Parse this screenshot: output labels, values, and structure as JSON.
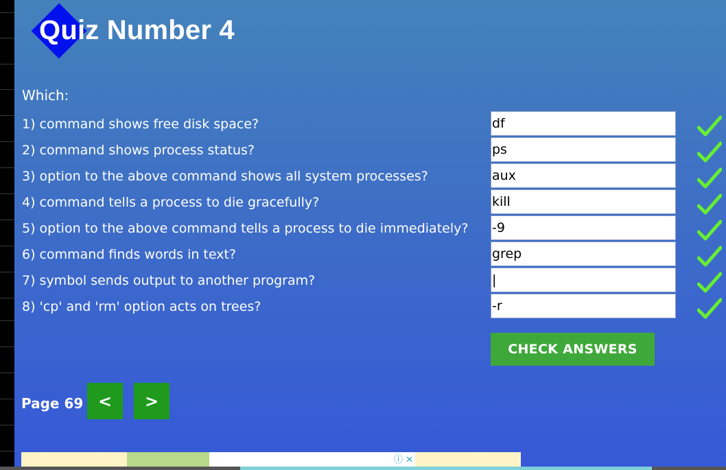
{
  "page": {
    "title": "Quiz Number 4",
    "intro": "Which:"
  },
  "questions": [
    {
      "text": "1) command shows free disk space?",
      "answer": "df"
    },
    {
      "text": "2) command shows process status?",
      "answer": "ps"
    },
    {
      "text": "3) option to the above command shows all system processes?",
      "answer": "aux"
    },
    {
      "text": "4) command tells a process to die gracefully?",
      "answer": "kill"
    },
    {
      "text": "5) option to the above command tells a process to die immediately?",
      "answer": "-9"
    },
    {
      "text": "6) command finds words in text?",
      "answer": "grep"
    },
    {
      "text": "7) symbol sends output to another program?",
      "answer": "|"
    },
    {
      "text": "8) 'cp' and 'rm' option acts on trees?",
      "answer": "-r"
    }
  ],
  "check_icon": "checkmark-icon",
  "check_color": "#66ee33",
  "check_button_label": "CHECK ANSWERS",
  "pagination": {
    "label": "Page 69",
    "prev_label": "<",
    "next_label": ">"
  },
  "ad": {
    "info_text": "ⓘ ✕"
  },
  "colors": {
    "button_green": "#3fa83a",
    "nav_green": "#1f9a1c",
    "diamond": "#0011ee"
  }
}
